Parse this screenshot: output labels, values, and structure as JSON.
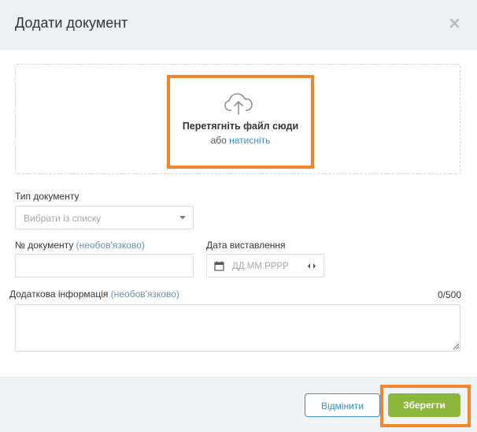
{
  "dialog": {
    "title": "Додати документ",
    "close_icon": "close-icon"
  },
  "dropzone": {
    "icon": "cloud-upload-icon",
    "title": "Перетягніть файл сюди",
    "or_text": "або",
    "click_link": "натисніть"
  },
  "form": {
    "doc_type": {
      "label": "Тип документу",
      "placeholder": "Вибрати із списку"
    },
    "doc_number": {
      "label": "№ документу",
      "optional": "(необов'язково)",
      "value": ""
    },
    "issue_date": {
      "label": "Дата виставлення",
      "placeholder": "ДД.ММ.РРРР",
      "icon": "calendar-icon"
    },
    "additional_info": {
      "label": "Додаткова інформація",
      "optional": "(необов'язково)",
      "counter": "0/500",
      "value": ""
    }
  },
  "footer": {
    "cancel_label": "Відмінити",
    "save_label": "Зберегти"
  },
  "colors": {
    "highlight": "#f5852b",
    "save_button": "#8cb63c",
    "link": "#3e8dc3",
    "header_bg": "#ebf1f4"
  }
}
